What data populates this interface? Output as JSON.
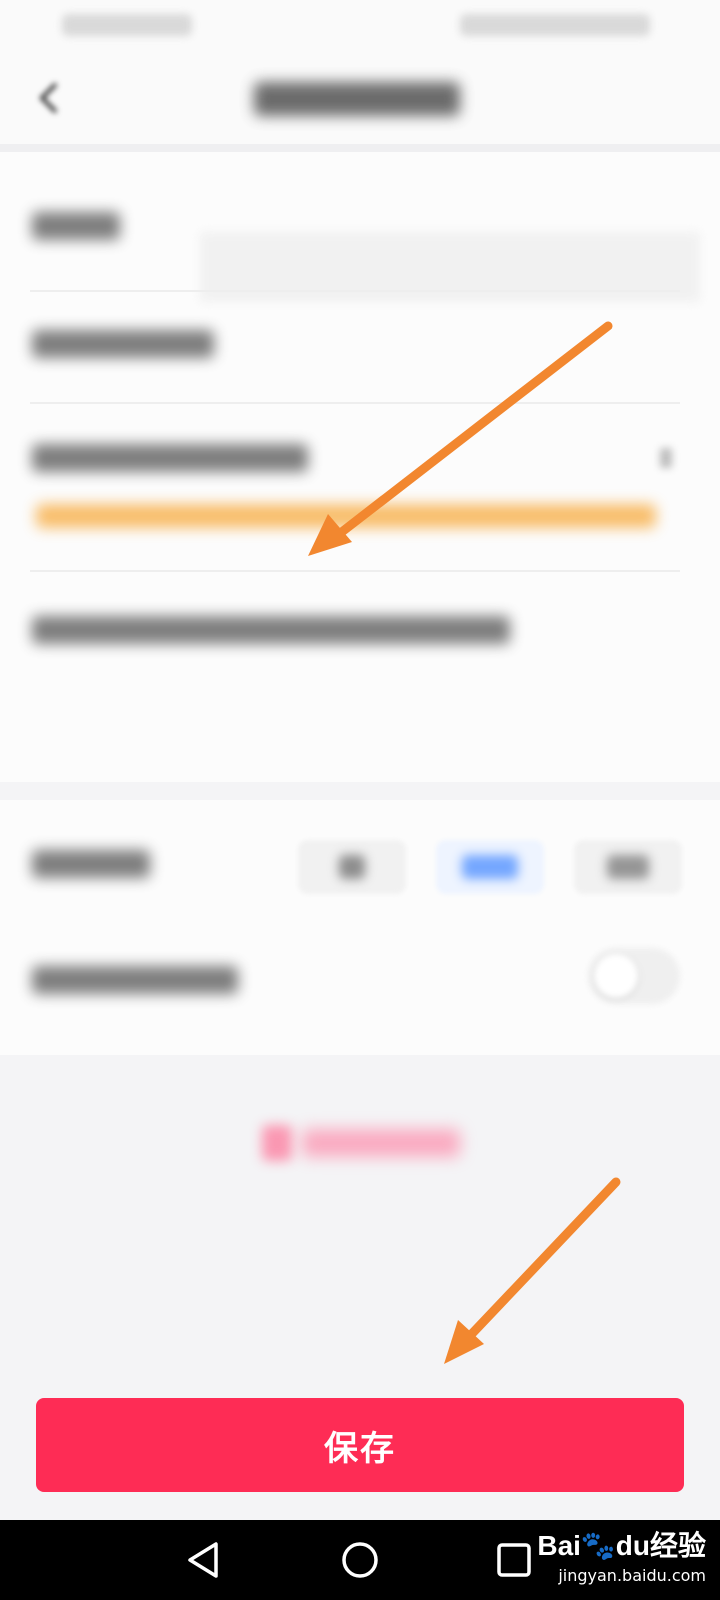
{
  "colors": {
    "accent": "#fe2c55",
    "annotation_arrow": "#f2872f",
    "warning": "#f7a32c",
    "selected_chip": "#4a8cff"
  },
  "save_button": {
    "label": "保存"
  },
  "watermark": {
    "logo": "Bai🐾du经验",
    "url": "jingyan.baidu.com"
  },
  "obscured": {
    "note": ""
  }
}
